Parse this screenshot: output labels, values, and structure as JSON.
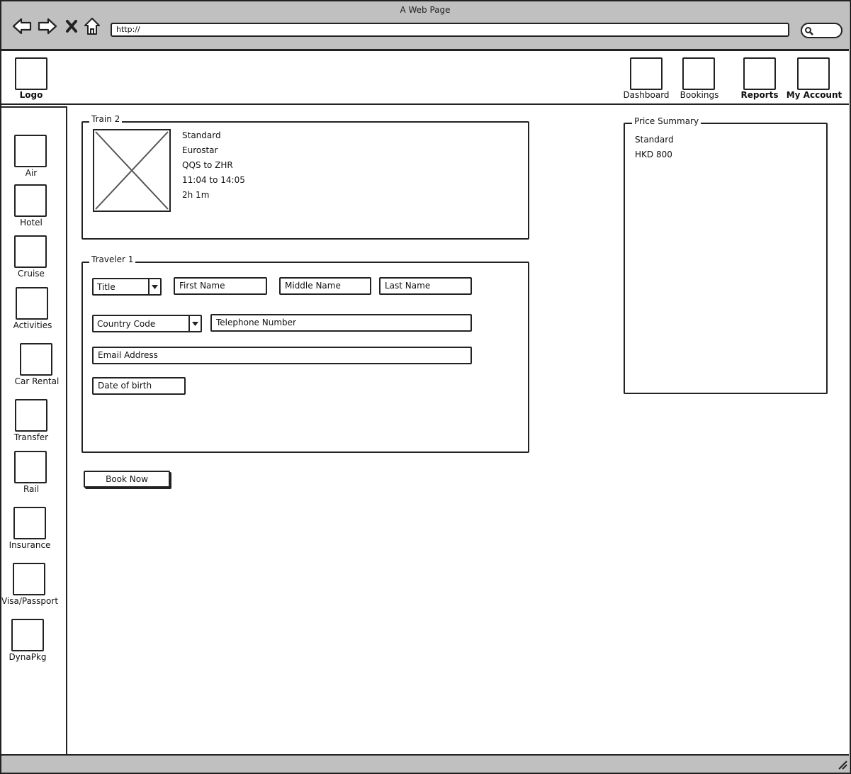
{
  "window": {
    "title": "A Web Page",
    "url": "http://"
  },
  "header": {
    "logo_label": "Logo",
    "nav": [
      "Dashboard",
      "Bookings",
      "Reports",
      "My Account"
    ]
  },
  "sidebar": {
    "items": [
      "Air",
      "Hotel",
      "Cruise",
      "Activities",
      "Car Rental",
      "Transfer",
      "Rail",
      "Insurance",
      "Visa/Passport",
      "DynaPkg"
    ]
  },
  "train": {
    "legend": "Train 2",
    "class": "Standard",
    "operator": "Eurostar",
    "route": "QQS to ZHR",
    "times": "11:04 to 14:05",
    "duration": "2h 1m"
  },
  "traveler": {
    "legend": "Traveler 1",
    "title_select": "Title",
    "first_name": "First Name",
    "middle_name": "Middle Name",
    "last_name": "Last Name",
    "country_code": "Country Code",
    "telephone": "Telephone Number",
    "email": "Email Address",
    "dob": "Date of birth"
  },
  "book_button": "Book Now",
  "price_summary": {
    "legend": "Price Summary",
    "class": "Standard",
    "amount": "HKD 800"
  }
}
